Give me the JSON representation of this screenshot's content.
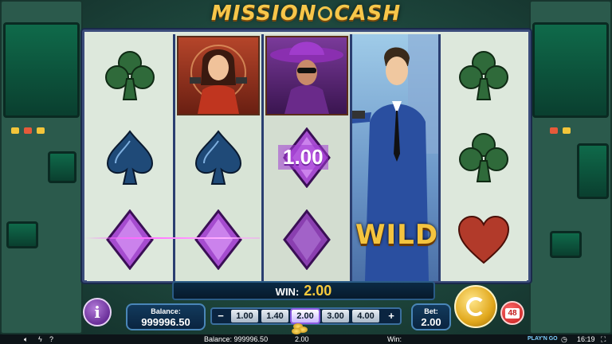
{
  "game": {
    "title_left": "MISSION",
    "title_right": "CASH"
  },
  "reels": {
    "reel3_badge_value": "1.00",
    "wild_label": "WILD"
  },
  "win": {
    "label": "WIN:",
    "value": "2.00"
  },
  "controls": {
    "info_label": "i",
    "balance_label": "Balance:",
    "balance_value": "999996.50",
    "bet_minus": "−",
    "bet_plus": "+",
    "bet_options": [
      "1.00",
      "1.40",
      "2.00",
      "3.00",
      "4.00"
    ],
    "bet_selected": "2.00",
    "bet_label": "Bet:",
    "bet_value": "2.00",
    "autoplay_count": "48"
  },
  "status_bar": {
    "balance_text": "Balance: 999996.50",
    "bet_text": "2.00",
    "win_text": "Win:",
    "brand": "PLAY'N GO",
    "time": "16:19"
  },
  "colors": {
    "gold": "#f6c64a",
    "purple": "#8a5ae0",
    "club_green": "#2f6a3a",
    "spade_blue": "#1f4a78",
    "diamond_purple": "#a54ccf",
    "heart_red": "#b23a2a"
  },
  "icons": [
    "club-icon",
    "spade-icon",
    "diamond-icon",
    "heart-icon",
    "sound-icon",
    "lightning-icon",
    "help-icon",
    "settings-icon",
    "home-icon",
    "fullscreen-icon",
    "clock-icon"
  ]
}
